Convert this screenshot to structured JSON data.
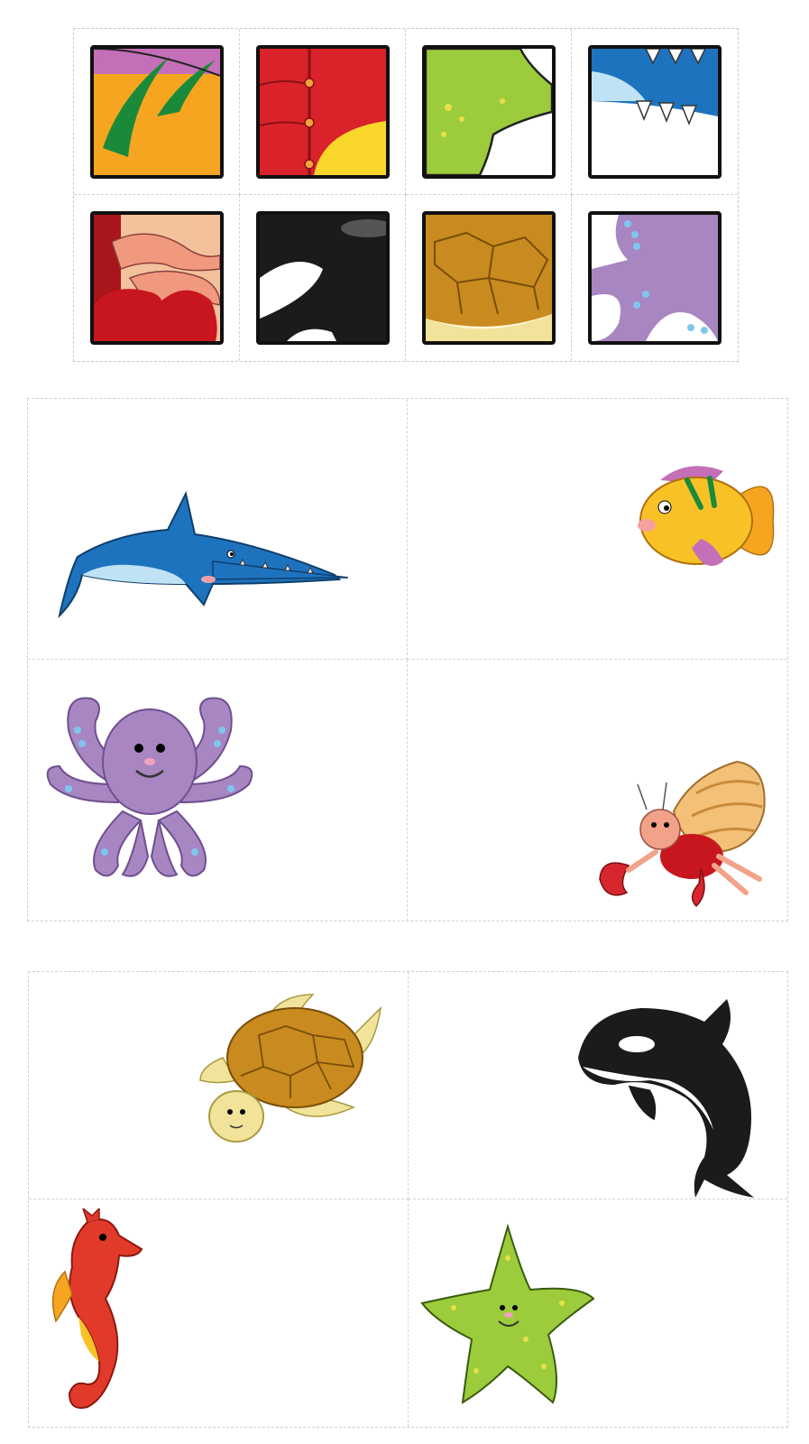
{
  "puzzle_tiles": [
    {
      "icon": "fish-fin-detail-icon"
    },
    {
      "icon": "hermit-crab-shell-detail-icon"
    },
    {
      "icon": "starfish-detail-icon"
    },
    {
      "icon": "sawfish-teeth-detail-icon"
    },
    {
      "icon": "crab-claw-detail-icon"
    },
    {
      "icon": "orca-detail-icon"
    },
    {
      "icon": "turtle-shell-detail-icon"
    },
    {
      "icon": "octopus-tentacle-detail-icon"
    }
  ],
  "cards_sheet_1": [
    {
      "icon": "sawfish-icon"
    },
    {
      "icon": "tropical-fish-icon"
    },
    {
      "icon": "octopus-icon"
    },
    {
      "icon": "hermit-crab-icon"
    }
  ],
  "cards_sheet_2": [
    {
      "icon": "sea-turtle-icon"
    },
    {
      "icon": "orca-icon"
    },
    {
      "icon": "seahorse-icon"
    },
    {
      "icon": "starfish-icon"
    }
  ],
  "colors": {
    "fish_yellow": "#f5b31c",
    "crab_red": "#d7262d",
    "starfish_green": "#9ccc3b",
    "sawfish_blue": "#1e73be",
    "orca_black": "#1a1a1a",
    "turtle_brown": "#c98b1f",
    "octopus_purple": "#a886c2",
    "seahorse_red": "#e23a2a"
  }
}
